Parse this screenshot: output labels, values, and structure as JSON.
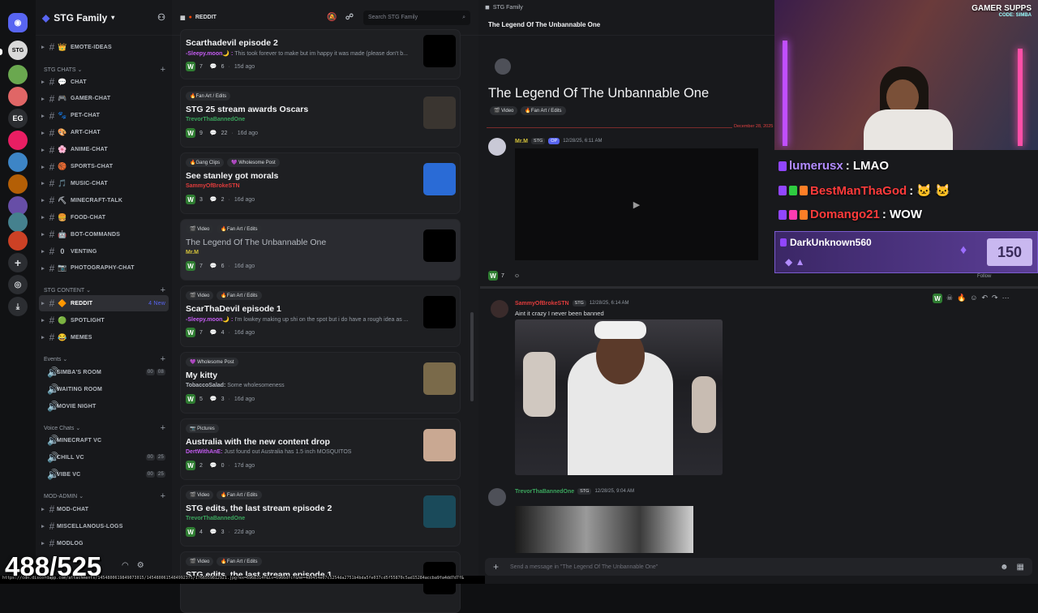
{
  "server": {
    "name": "STG Family"
  },
  "channels": {
    "top": [
      {
        "emoji": "👑",
        "label": "EMOTE-IDEAS"
      }
    ],
    "chats_label": "STG CHATS",
    "chats": [
      {
        "emoji": "💬",
        "label": "CHAT"
      },
      {
        "emoji": "🎮",
        "label": "GAMER-CHAT"
      },
      {
        "emoji": "🐾",
        "label": "PET-CHAT"
      },
      {
        "emoji": "🎨",
        "label": "ART-CHAT"
      },
      {
        "emoji": "🌸",
        "label": "ANIME-CHAT"
      },
      {
        "emoji": "🏀",
        "label": "SPORTS-CHAT"
      },
      {
        "emoji": "🎵",
        "label": "MUSIC-CHAT"
      },
      {
        "emoji": "⛏",
        "label": "MINECRAFT-TALK"
      },
      {
        "emoji": "🍔",
        "label": "FOOD-CHAT"
      },
      {
        "emoji": "🤖",
        "label": "BOT-COMMANDS"
      },
      {
        "emoji": "0",
        "label": "VENTING"
      },
      {
        "emoji": "📷",
        "label": "PHOTOGRAPHY-CHAT"
      }
    ],
    "content_label": "STG CONTENT",
    "content": [
      {
        "emoji": "🔶",
        "label": "REDDIT",
        "badge": "4 New"
      },
      {
        "emoji": "🟢",
        "label": "SPOTLIGHT"
      },
      {
        "emoji": "😂",
        "label": "MEMES"
      }
    ],
    "events_label": "Events",
    "events": [
      {
        "label": "SIMBA'S ROOM",
        "c1": "00",
        "c2": "08"
      },
      {
        "label": "WAITING ROOM"
      },
      {
        "label": "MOVIE NIGHT"
      }
    ],
    "voice_label": "Voice Chats",
    "voice": [
      {
        "label": "MINECRAFT VC"
      },
      {
        "label": "CHILL VC",
        "c1": "00",
        "c2": "25"
      },
      {
        "label": "VIBE VC",
        "c1": "00",
        "c2": "25"
      }
    ],
    "mod_label": "MOD-ADMIN",
    "mod": [
      {
        "label": "MOD-CHAT"
      },
      {
        "label": "MISCELLANOUS-LOGS"
      },
      {
        "label": "MODLOG"
      }
    ]
  },
  "forum": {
    "channel": "REDDIT",
    "search_placeholder": "Search STG Family",
    "posts": [
      {
        "tags": [],
        "title": "Scarthadevil episode 2",
        "author": "-Sleepy.moon🌙 :",
        "author_color": "#c45cf2",
        "preview": " This took forever to make but im happy it was made (please don't b...",
        "likes": "7",
        "comments": "6",
        "age": "15d ago",
        "thumb": "#000000"
      },
      {
        "tags": [
          "🔥Fan Art / Edits"
        ],
        "title": "STG 25 stream awards Oscars",
        "author": "TrevorThaBannedOne",
        "author_color": "#3ba55d",
        "preview": "",
        "likes": "9",
        "comments": "22",
        "age": "16d ago",
        "thumb": "#3a3530"
      },
      {
        "tags": [
          "🔥Gang Clips",
          "💜 Wholesome Post"
        ],
        "title": "See stanley got morals",
        "author": "SammyOfBrokeSTN",
        "author_color": "#e03c3c",
        "preview": "",
        "likes": "3",
        "comments": "2",
        "age": "16d ago",
        "thumb": "#2a6bd6"
      },
      {
        "tags": [
          "🎬 Video",
          "🔥Fan Art / Edits"
        ],
        "title": "The Legend Of The Unbannable One",
        "author": "Mr.M",
        "author_color": "#d4c23a",
        "preview": "",
        "likes": "7",
        "comments": "6",
        "age": "16d ago",
        "thumb": "#000000"
      },
      {
        "tags": [
          "🎬 Video",
          "🔥Fan Art / Edits"
        ],
        "title": "ScarThaDevil episode 1",
        "author": "-Sleepy.moon🌙 :",
        "author_color": "#c45cf2",
        "preview": " I'm lowkey making up shi on the spot but i do have a rough idea as ...",
        "likes": "7",
        "comments": "4",
        "age": "16d ago",
        "thumb": "#000000"
      },
      {
        "tags": [
          "💜 Wholesome Post"
        ],
        "title": "My kitty",
        "author": "TobaccoSalad:",
        "author_color": "#b5bac1",
        "preview": " Some wholesomeness",
        "likes": "5",
        "comments": "3",
        "age": "16d ago",
        "thumb": "#7a6a4a"
      },
      {
        "tags": [
          "📷 Pictures"
        ],
        "title": "Australia with the new content drop",
        "author": "DertWithAnE:",
        "author_color": "#c45cf2",
        "preview": " Just found out Australia has 1.5 inch MOSQUITOS",
        "likes": "2",
        "comments": "0",
        "age": "17d ago",
        "thumb": "#c9a892"
      },
      {
        "tags": [
          "🎬 Video",
          "🔥Fan Art / Edits"
        ],
        "title": "STG edits, the last stream episode 2",
        "author": "TrevorThaBannedOne",
        "author_color": "#3ba55d",
        "preview": "",
        "likes": "4",
        "comments": "3",
        "age": "22d ago",
        "thumb": "#1a4a5a"
      },
      {
        "tags": [
          "🎬 Video",
          "🔥Fan Art / Edits"
        ],
        "title": "STG edits, the last stream episode 1",
        "author": "",
        "author_color": "#3ba55d",
        "preview": "",
        "likes": "",
        "comments": "",
        "age": "",
        "thumb": "#000000"
      }
    ]
  },
  "thread": {
    "window_title": "STG Family",
    "bar_title": "The Legend Of The Unbannable One",
    "title": "The Legend Of The Unbannable One",
    "tags": [
      "🎬 Video",
      "🔥Fan Art / Edits"
    ],
    "divider_date": "December 28, 2025",
    "messages": [
      {
        "author": "Mr.M",
        "author_color": "#d4c23a",
        "badge": "STG",
        "op": "OP",
        "time": "12/28/25, 6:11 AM",
        "text": ""
      },
      {
        "author": "SammyOfBrokeSTN",
        "author_color": "#e03c3c",
        "badge": "STG",
        "op": "",
        "time": "12/28/25, 6:14 AM",
        "text": "Aint it crazy I never been banned"
      },
      {
        "author": "TrevorThaBannedOne",
        "author_color": "#3ba55d",
        "badge": "STG",
        "op": "",
        "time": "12/28/25, 9:04 AM",
        "text": ""
      }
    ],
    "reaction_count": "7",
    "composer_placeholder": "Send a message in \"The Legend Of The Unbannable One\""
  },
  "overlay": {
    "brand": "GAMER SUPPS",
    "code": "CODE: SIMBA",
    "chat": [
      {
        "user": "lumerusx",
        "color": "#b28cff",
        "msg": ": LMAO"
      },
      {
        "user": "BestManThaGod",
        "color": "#ff3b3b",
        "msg": ":  🐱  🐱"
      },
      {
        "user": "Domango21",
        "color": "#ff3b3b",
        "msg": ": WOW"
      }
    ],
    "sub_user": "DarkUnknown560",
    "sub_amount": "150",
    "counter": "488/525",
    "follow": "Follow"
  },
  "url_text": "https://cdn.discordapp.com/attachments/1454800619849073015/1454800615484992375/1766559812921.jpg?ex=6968314f&is=6966dfcf&hm=4d0454e07c5254da2751b4bda5fe037cd5f55870c5ad15284accba9fa4dd7d7f&"
}
